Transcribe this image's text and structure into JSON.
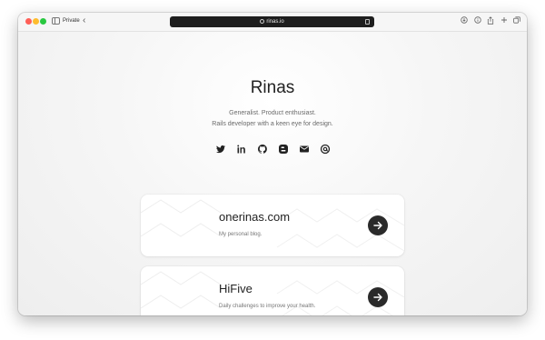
{
  "browser": {
    "private_label": "Private",
    "back_glyph": "‹",
    "url": "rinas.io",
    "toolbar_icons": [
      "download-icon",
      "info-icon",
      "share-icon",
      "new-tab-icon",
      "tab-overview-icon"
    ]
  },
  "profile": {
    "name": "Rinas",
    "tagline_line1": "Generalist. Product enthusiast.",
    "tagline_line2": "Rails developer with a keen eye for design."
  },
  "social_links": [
    {
      "icon": "twitter-icon"
    },
    {
      "icon": "linkedin-icon"
    },
    {
      "icon": "github-icon"
    },
    {
      "icon": "blogger-icon"
    },
    {
      "icon": "email-icon"
    },
    {
      "icon": "threads-icon"
    }
  ],
  "cards": [
    {
      "title": "onerinas.com",
      "description": "My personal blog."
    },
    {
      "title": "HiFive",
      "description": "Daily challenges to improve your health."
    }
  ],
  "colors": {
    "accent_dark": "#2a2a2a",
    "text": "#222222",
    "muted": "#777777"
  }
}
